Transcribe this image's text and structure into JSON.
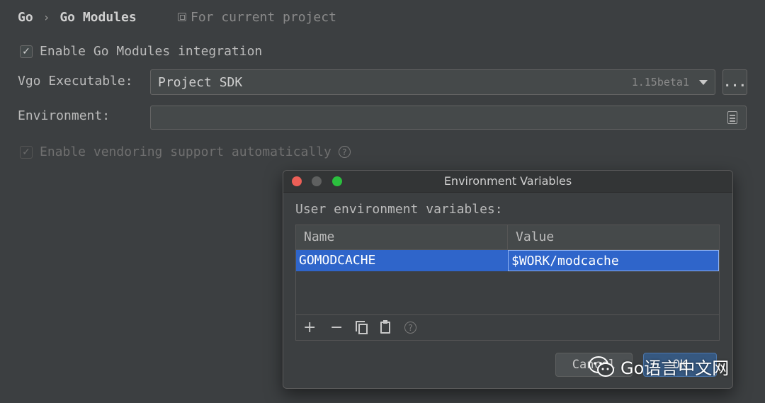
{
  "breadcrumb": {
    "root": "Go",
    "separator": "›",
    "current": "Go Modules"
  },
  "scope_label": "For current project",
  "enable_modules": {
    "label": "Enable Go Modules integration",
    "checked": true
  },
  "vgo": {
    "label": "Vgo Executable:",
    "value": "Project SDK",
    "version": "1.15beta1",
    "browse": "..."
  },
  "environment": {
    "label": "Environment:",
    "value": ""
  },
  "vendoring": {
    "label": "Enable vendoring support automatically",
    "help": "?"
  },
  "dialog": {
    "title": "Environment Variables",
    "section_label": "User environment variables:",
    "columns": {
      "name": "Name",
      "value": "Value"
    },
    "rows": [
      {
        "name": "GOMODCACHE",
        "value": "$WORK/modcache"
      }
    ],
    "toolbar": {
      "add": "+",
      "remove": "−",
      "help": "?"
    },
    "cancel_label": "Cancel",
    "ok_label": "OK"
  },
  "watermark": "Go语言中文网",
  "colors": {
    "close": "#ec5f57",
    "minimize": "#5f6060",
    "zoom": "#2bbf3e",
    "selection": "#2f65ca"
  }
}
